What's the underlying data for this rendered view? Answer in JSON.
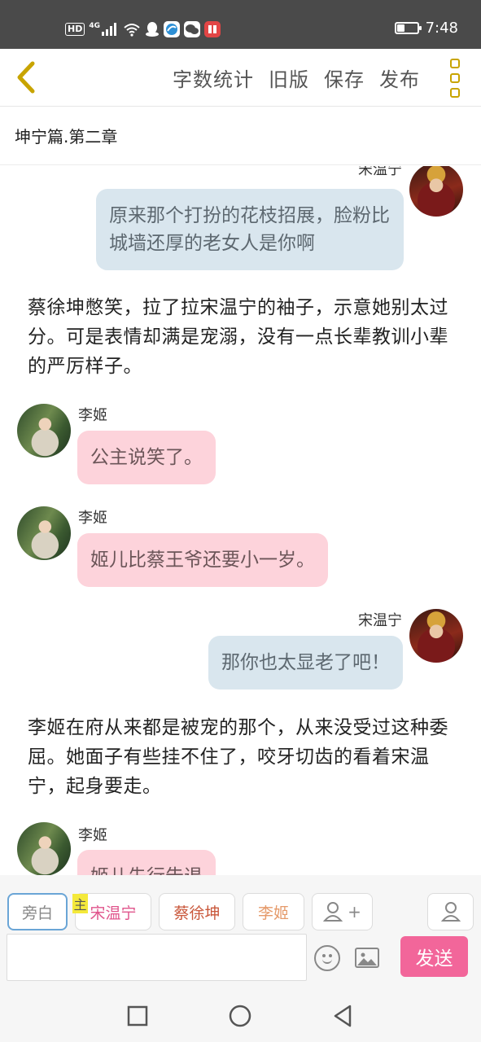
{
  "status_bar": {
    "hd": "HD",
    "network": "4G",
    "time": "7:48",
    "icons": [
      "hd-icon",
      "signal-icon",
      "wifi-icon",
      "qq-icon",
      "browser-icon",
      "wechat-icon",
      "reader-app-icon",
      "battery-icon"
    ]
  },
  "toolbar": {
    "word_count": "字数统计",
    "old_version": "旧版",
    "save": "保存",
    "publish": "发布"
  },
  "chapter": {
    "title": "坤宁篇.第二章"
  },
  "messages": {
    "m1": {
      "speaker": "宋温宁",
      "text": "原来那个打扮的花枝招展，脸粉比城墙还厚的老女人是你啊"
    },
    "n1": {
      "text": "蔡徐坤憋笑，拉了拉宋温宁的袖子，示意她别太过分。可是表情却满是宠溺，没有一点长辈教训小辈的严厉样子。"
    },
    "m2": {
      "speaker": "李姬",
      "text": "公主说笑了。"
    },
    "m3": {
      "speaker": "李姬",
      "text": "姬儿比蔡王爷还要小一岁。"
    },
    "m4": {
      "speaker": "宋温宁",
      "text": "那你也太显老了吧！"
    },
    "n2": {
      "text": "李姬在府从来都是被宠的那个，从来没受过这种委屈。她面子有些挂不住了，咬牙切齿的看着宋温宁，起身要走。"
    },
    "m5": {
      "speaker": "李姬",
      "text": "姬儿先行告退"
    }
  },
  "roles": {
    "narrator": "旁白",
    "main_mark": "主",
    "role1": "宋温宁",
    "role2": "蔡徐坤",
    "role3": "李姬",
    "add_plus": "+"
  },
  "input": {
    "placeholder": "",
    "send": "发送"
  },
  "colors": {
    "bubble_right": "#d9e6ee",
    "bubble_left": "#fdd3db",
    "send_button": "#f2669a",
    "accent_yellow": "#c8a400",
    "role1": "#e0558c",
    "role2": "#c9573a",
    "role3": "#e59a6a"
  }
}
